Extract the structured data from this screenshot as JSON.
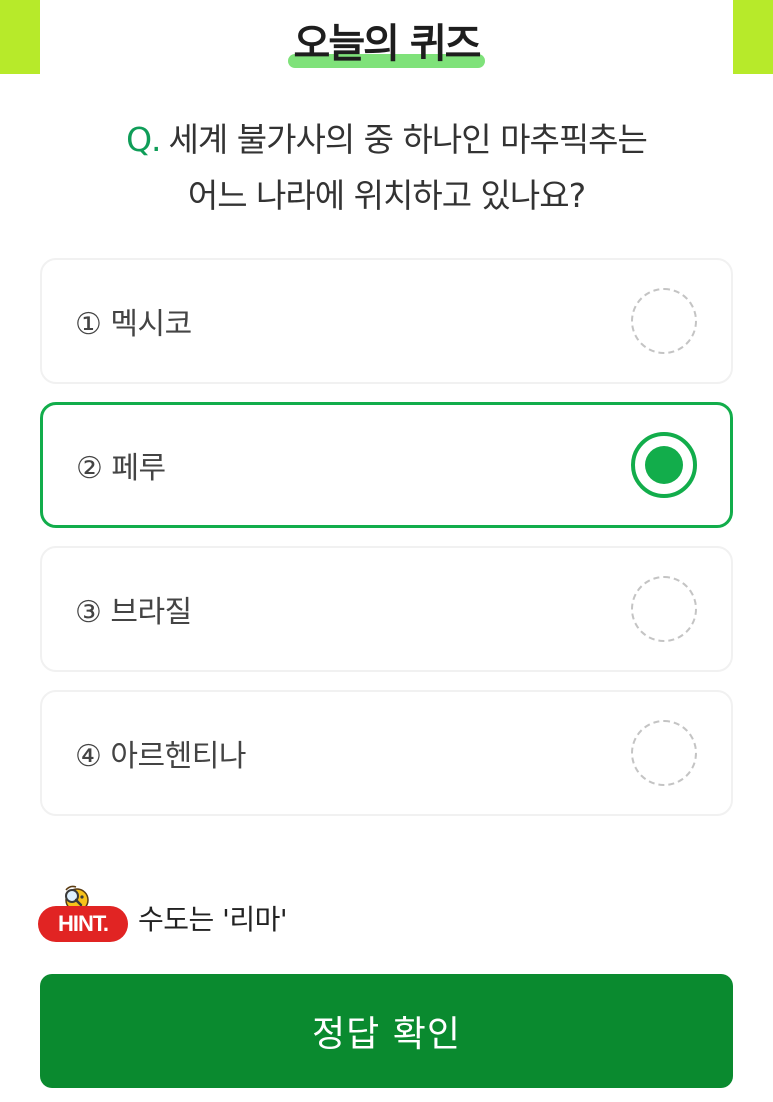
{
  "header": {
    "title": "오늘의 퀴즈",
    "accent_color": "#b7ea2a",
    "underline_color": "#7fe27a"
  },
  "question": {
    "prefix": "Q.",
    "line1": "세계 불가사의 중 하나인 마추픽추는",
    "line2": "어느 나라에 위치하고 있나요?"
  },
  "options": [
    {
      "label": "① 멕시코",
      "selected": false
    },
    {
      "label": "② 페루",
      "selected": true
    },
    {
      "label": "③ 브라질",
      "selected": false
    },
    {
      "label": "④ 아르헨티나",
      "selected": false
    }
  ],
  "hint": {
    "badge": "HINT.",
    "text": "수도는 '리마'",
    "icon": "magnifier-mascot-icon",
    "badge_color": "#e12423"
  },
  "confirm_button": {
    "label": "정답 확인",
    "color": "#0a8a2f"
  },
  "colors": {
    "selected": "#12ad4b",
    "question_prefix": "#0f9d58"
  }
}
